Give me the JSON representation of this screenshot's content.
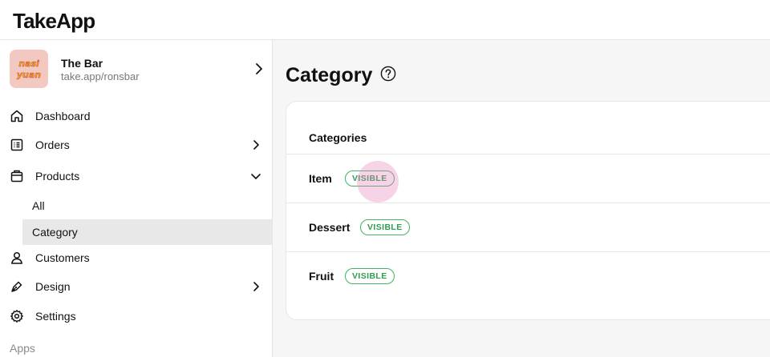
{
  "app": {
    "logo": "TakeApp"
  },
  "store": {
    "name": "The Bar",
    "url": "take.app/ronsbar",
    "avatar_text": "nasi yuan"
  },
  "nav": {
    "items": [
      {
        "label": "Dashboard",
        "icon": "home-icon"
      },
      {
        "label": "Orders",
        "icon": "orders-icon"
      },
      {
        "label": "Products",
        "icon": "products-icon"
      },
      {
        "label": "Customers",
        "icon": "user-icon"
      },
      {
        "label": "Design",
        "icon": "pen-icon"
      },
      {
        "label": "Settings",
        "icon": "gear-icon"
      }
    ],
    "product_sub": [
      {
        "label": "All"
      },
      {
        "label": "Category",
        "active": true
      }
    ],
    "apps_label": "Apps"
  },
  "page": {
    "title": "Category"
  },
  "categories": {
    "header": "Categories",
    "rows": [
      {
        "name": "Item",
        "status": "VISIBLE"
      },
      {
        "name": "Dessert",
        "status": "VISIBLE"
      },
      {
        "name": "Fruit",
        "status": "VISIBLE"
      }
    ]
  },
  "colors": {
    "badge_green": "#3fb560",
    "active_bg": "#e8e8e8",
    "main_bg": "#f6f6f7"
  }
}
